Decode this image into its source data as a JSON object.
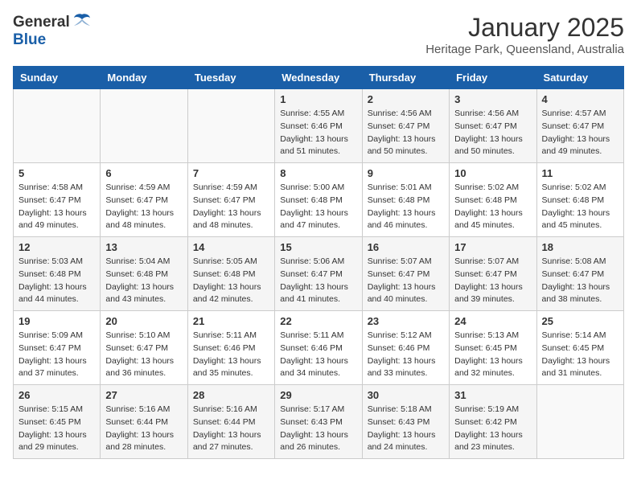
{
  "header": {
    "logo_general": "General",
    "logo_blue": "Blue",
    "month": "January 2025",
    "location": "Heritage Park, Queensland, Australia"
  },
  "weekdays": [
    "Sunday",
    "Monday",
    "Tuesday",
    "Wednesday",
    "Thursday",
    "Friday",
    "Saturday"
  ],
  "weeks": [
    [
      {
        "day": "",
        "info": ""
      },
      {
        "day": "",
        "info": ""
      },
      {
        "day": "",
        "info": ""
      },
      {
        "day": "1",
        "info": "Sunrise: 4:55 AM\nSunset: 6:46 PM\nDaylight: 13 hours\nand 51 minutes."
      },
      {
        "day": "2",
        "info": "Sunrise: 4:56 AM\nSunset: 6:47 PM\nDaylight: 13 hours\nand 50 minutes."
      },
      {
        "day": "3",
        "info": "Sunrise: 4:56 AM\nSunset: 6:47 PM\nDaylight: 13 hours\nand 50 minutes."
      },
      {
        "day": "4",
        "info": "Sunrise: 4:57 AM\nSunset: 6:47 PM\nDaylight: 13 hours\nand 49 minutes."
      }
    ],
    [
      {
        "day": "5",
        "info": "Sunrise: 4:58 AM\nSunset: 6:47 PM\nDaylight: 13 hours\nand 49 minutes."
      },
      {
        "day": "6",
        "info": "Sunrise: 4:59 AM\nSunset: 6:47 PM\nDaylight: 13 hours\nand 48 minutes."
      },
      {
        "day": "7",
        "info": "Sunrise: 4:59 AM\nSunset: 6:47 PM\nDaylight: 13 hours\nand 48 minutes."
      },
      {
        "day": "8",
        "info": "Sunrise: 5:00 AM\nSunset: 6:48 PM\nDaylight: 13 hours\nand 47 minutes."
      },
      {
        "day": "9",
        "info": "Sunrise: 5:01 AM\nSunset: 6:48 PM\nDaylight: 13 hours\nand 46 minutes."
      },
      {
        "day": "10",
        "info": "Sunrise: 5:02 AM\nSunset: 6:48 PM\nDaylight: 13 hours\nand 45 minutes."
      },
      {
        "day": "11",
        "info": "Sunrise: 5:02 AM\nSunset: 6:48 PM\nDaylight: 13 hours\nand 45 minutes."
      }
    ],
    [
      {
        "day": "12",
        "info": "Sunrise: 5:03 AM\nSunset: 6:48 PM\nDaylight: 13 hours\nand 44 minutes."
      },
      {
        "day": "13",
        "info": "Sunrise: 5:04 AM\nSunset: 6:48 PM\nDaylight: 13 hours\nand 43 minutes."
      },
      {
        "day": "14",
        "info": "Sunrise: 5:05 AM\nSunset: 6:48 PM\nDaylight: 13 hours\nand 42 minutes."
      },
      {
        "day": "15",
        "info": "Sunrise: 5:06 AM\nSunset: 6:47 PM\nDaylight: 13 hours\nand 41 minutes."
      },
      {
        "day": "16",
        "info": "Sunrise: 5:07 AM\nSunset: 6:47 PM\nDaylight: 13 hours\nand 40 minutes."
      },
      {
        "day": "17",
        "info": "Sunrise: 5:07 AM\nSunset: 6:47 PM\nDaylight: 13 hours\nand 39 minutes."
      },
      {
        "day": "18",
        "info": "Sunrise: 5:08 AM\nSunset: 6:47 PM\nDaylight: 13 hours\nand 38 minutes."
      }
    ],
    [
      {
        "day": "19",
        "info": "Sunrise: 5:09 AM\nSunset: 6:47 PM\nDaylight: 13 hours\nand 37 minutes."
      },
      {
        "day": "20",
        "info": "Sunrise: 5:10 AM\nSunset: 6:47 PM\nDaylight: 13 hours\nand 36 minutes."
      },
      {
        "day": "21",
        "info": "Sunrise: 5:11 AM\nSunset: 6:46 PM\nDaylight: 13 hours\nand 35 minutes."
      },
      {
        "day": "22",
        "info": "Sunrise: 5:11 AM\nSunset: 6:46 PM\nDaylight: 13 hours\nand 34 minutes."
      },
      {
        "day": "23",
        "info": "Sunrise: 5:12 AM\nSunset: 6:46 PM\nDaylight: 13 hours\nand 33 minutes."
      },
      {
        "day": "24",
        "info": "Sunrise: 5:13 AM\nSunset: 6:45 PM\nDaylight: 13 hours\nand 32 minutes."
      },
      {
        "day": "25",
        "info": "Sunrise: 5:14 AM\nSunset: 6:45 PM\nDaylight: 13 hours\nand 31 minutes."
      }
    ],
    [
      {
        "day": "26",
        "info": "Sunrise: 5:15 AM\nSunset: 6:45 PM\nDaylight: 13 hours\nand 29 minutes."
      },
      {
        "day": "27",
        "info": "Sunrise: 5:16 AM\nSunset: 6:44 PM\nDaylight: 13 hours\nand 28 minutes."
      },
      {
        "day": "28",
        "info": "Sunrise: 5:16 AM\nSunset: 6:44 PM\nDaylight: 13 hours\nand 27 minutes."
      },
      {
        "day": "29",
        "info": "Sunrise: 5:17 AM\nSunset: 6:43 PM\nDaylight: 13 hours\nand 26 minutes."
      },
      {
        "day": "30",
        "info": "Sunrise: 5:18 AM\nSunset: 6:43 PM\nDaylight: 13 hours\nand 24 minutes."
      },
      {
        "day": "31",
        "info": "Sunrise: 5:19 AM\nSunset: 6:42 PM\nDaylight: 13 hours\nand 23 minutes."
      },
      {
        "day": "",
        "info": ""
      }
    ]
  ]
}
